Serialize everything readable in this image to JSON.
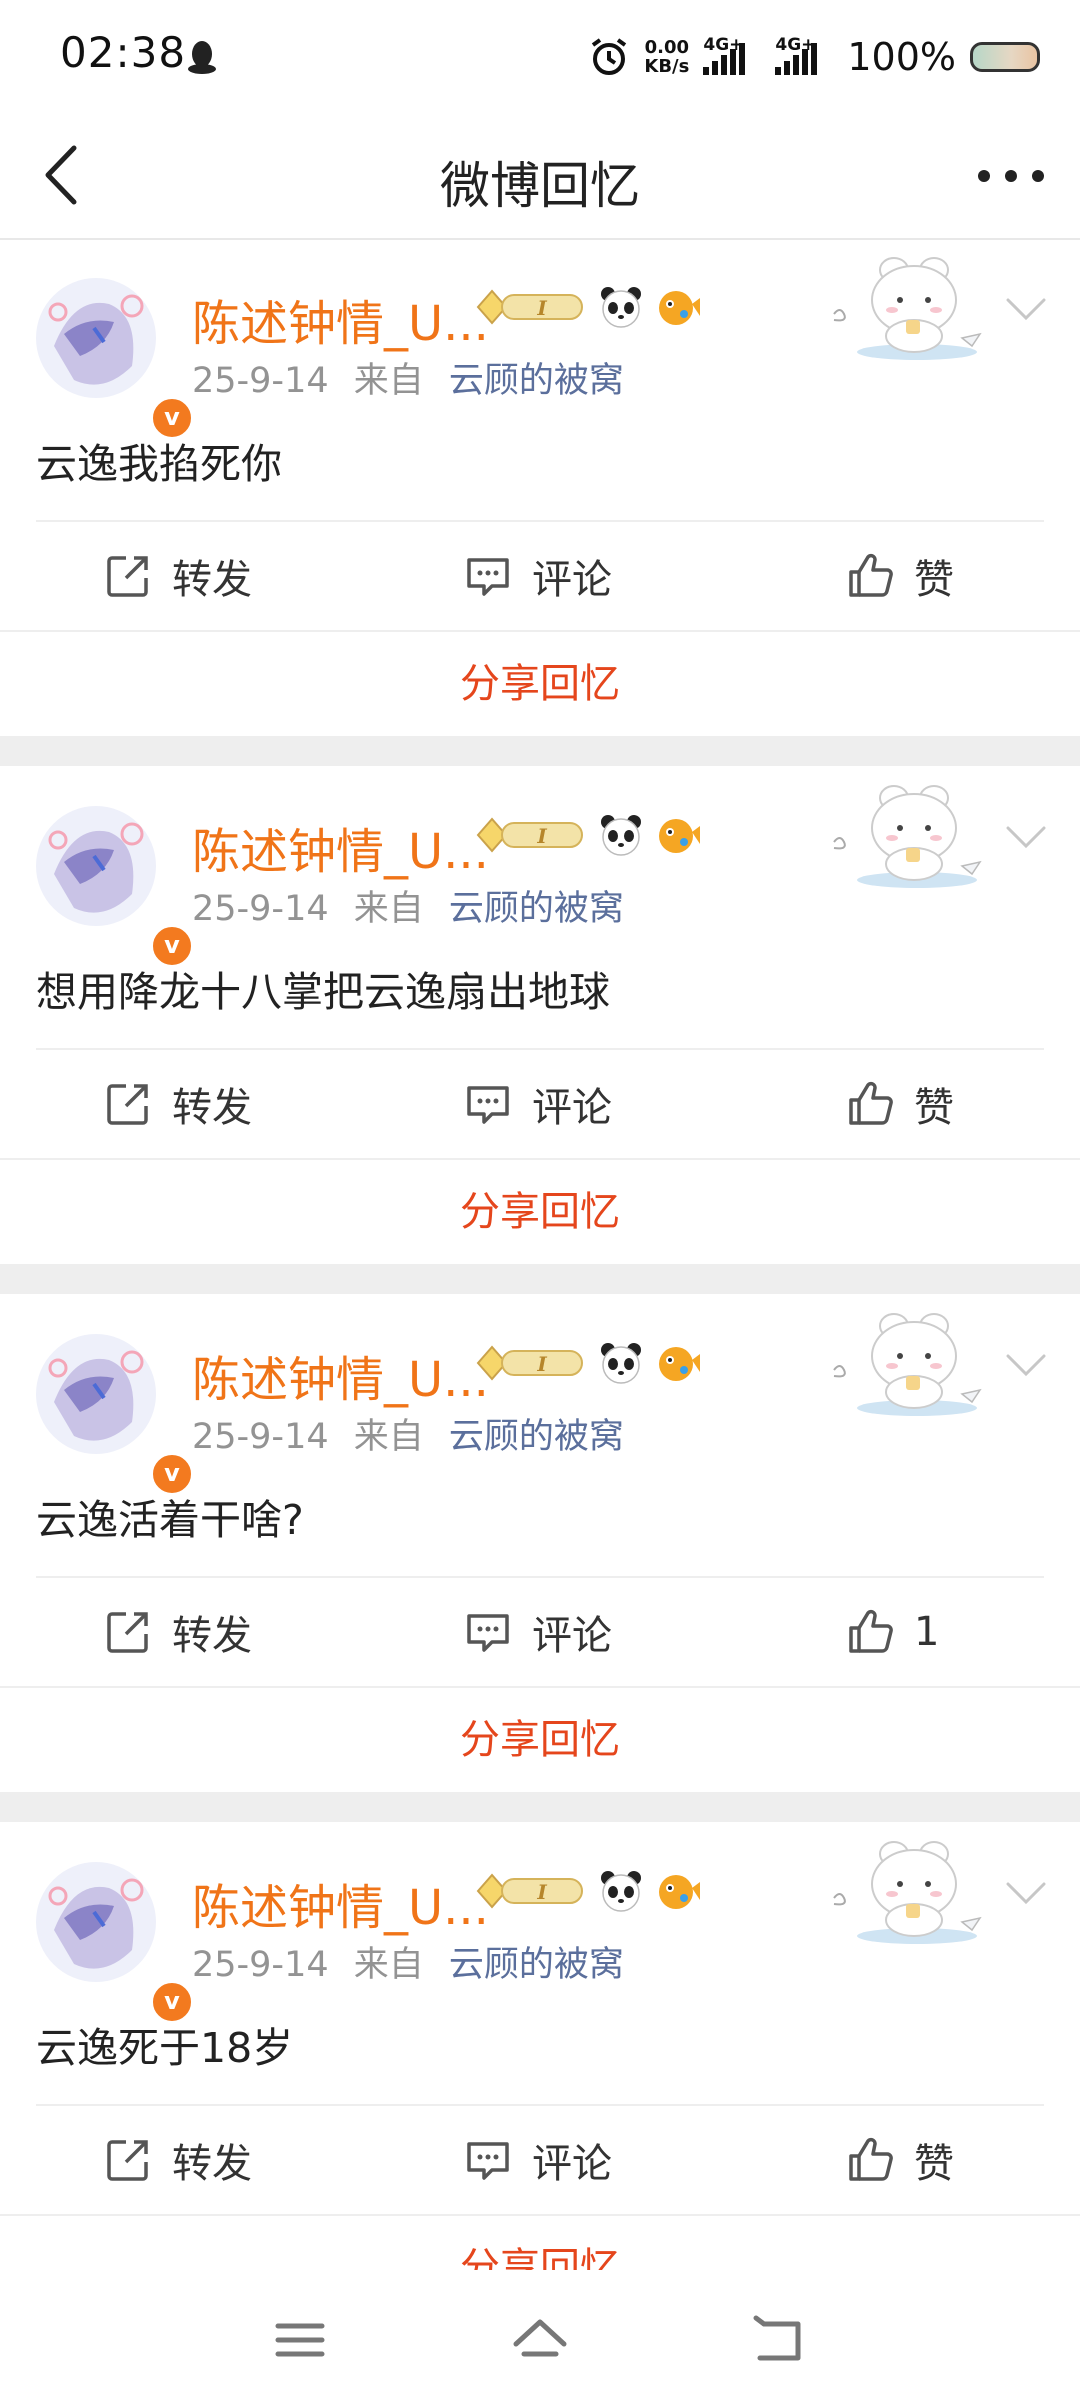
{
  "status_bar": {
    "time": "02:38",
    "net_speed": "0.00",
    "net_unit": "KB/s",
    "sig1": "4G+",
    "sig2": "4G+",
    "battery": "100%"
  },
  "header": {
    "title": "微博回忆"
  },
  "posts": [
    {
      "username": "陈述钟情_U...",
      "date": "25-9-14",
      "from_label": "来自",
      "source": "云顾的被窝",
      "content": "云逸我掐死你",
      "repost": "转发",
      "comment": "评论",
      "like": "赞",
      "share": "分享回忆"
    },
    {
      "username": "陈述钟情_U...",
      "date": "25-9-14",
      "from_label": "来自",
      "source": "云顾的被窝",
      "content": "想用降龙十八掌把云逸扇出地球",
      "repost": "转发",
      "comment": "评论",
      "like": "赞",
      "share": "分享回忆"
    },
    {
      "username": "陈述钟情_U...",
      "date": "25-9-14",
      "from_label": "来自",
      "source": "云顾的被窝",
      "content": "云逸活着干啥?",
      "repost": "转发",
      "comment": "评论",
      "like": "1",
      "share": "分享回忆"
    },
    {
      "username": "陈述钟情_U...",
      "date": "25-9-14",
      "from_label": "来自",
      "source": "云顾的被窝",
      "content": "云逸死于18岁",
      "repost": "转发",
      "comment": "评论",
      "like": "赞",
      "share": "分享回忆"
    }
  ],
  "colors": {
    "username": "#f07418",
    "source_link": "#5b6f9c",
    "share": "#e5461c",
    "badge": "#f37a1f"
  },
  "icons": [
    "qq-penguin-icon",
    "alarm-icon",
    "back-arrow-icon",
    "more-dots-icon",
    "verified-v-icon",
    "vip-level-badge-icon",
    "panda-emoji-icon",
    "pufferfish-emoji-icon",
    "bunny-sticker-icon",
    "chevron-down-icon",
    "repost-icon",
    "comment-icon",
    "thumbs-up-icon",
    "menu-lines-icon",
    "home-icon",
    "back-nav-icon"
  ]
}
